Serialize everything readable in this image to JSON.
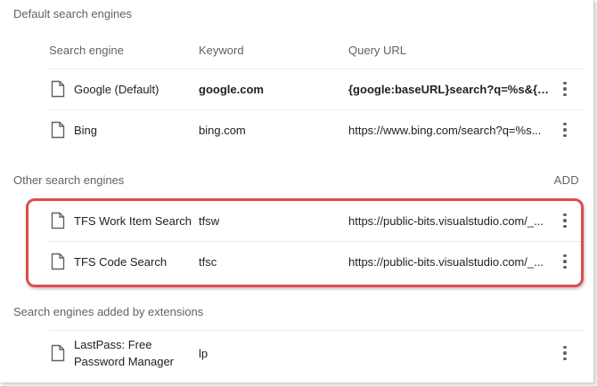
{
  "default_section": {
    "title": "Default search engines",
    "headers": {
      "name": "Search engine",
      "keyword": "Keyword",
      "url": "Query URL"
    },
    "rows": [
      {
        "name": "Google (Default)",
        "keyword": "google.com",
        "url": "{google:baseURL}search?q=%s&{go...",
        "is_default": true
      },
      {
        "name": "Bing",
        "keyword": "bing.com",
        "url": "https://www.bing.com/search?q=%s...",
        "is_default": false
      }
    ]
  },
  "other_section": {
    "title": "Other search engines",
    "add_label": "ADD",
    "rows": [
      {
        "name": "TFS Work Item Search",
        "keyword": "tfsw",
        "url": "https://public-bits.visualstudio.com/_..."
      },
      {
        "name": "TFS Code Search",
        "keyword": "tfsc",
        "url": "https://public-bits.visualstudio.com/_..."
      }
    ]
  },
  "extensions_section": {
    "title": "Search engines added by extensions",
    "rows": [
      {
        "name_line1": "LastPass: Free",
        "name_line2": "Password Manager",
        "keyword": "lp"
      }
    ]
  },
  "colors": {
    "highlight": "#e04b4b",
    "secondary_text": "#5f6368",
    "divider": "#e8eaed"
  },
  "icons": {
    "row_icon": "file-icon",
    "row_menu": "more-vert-icon"
  }
}
